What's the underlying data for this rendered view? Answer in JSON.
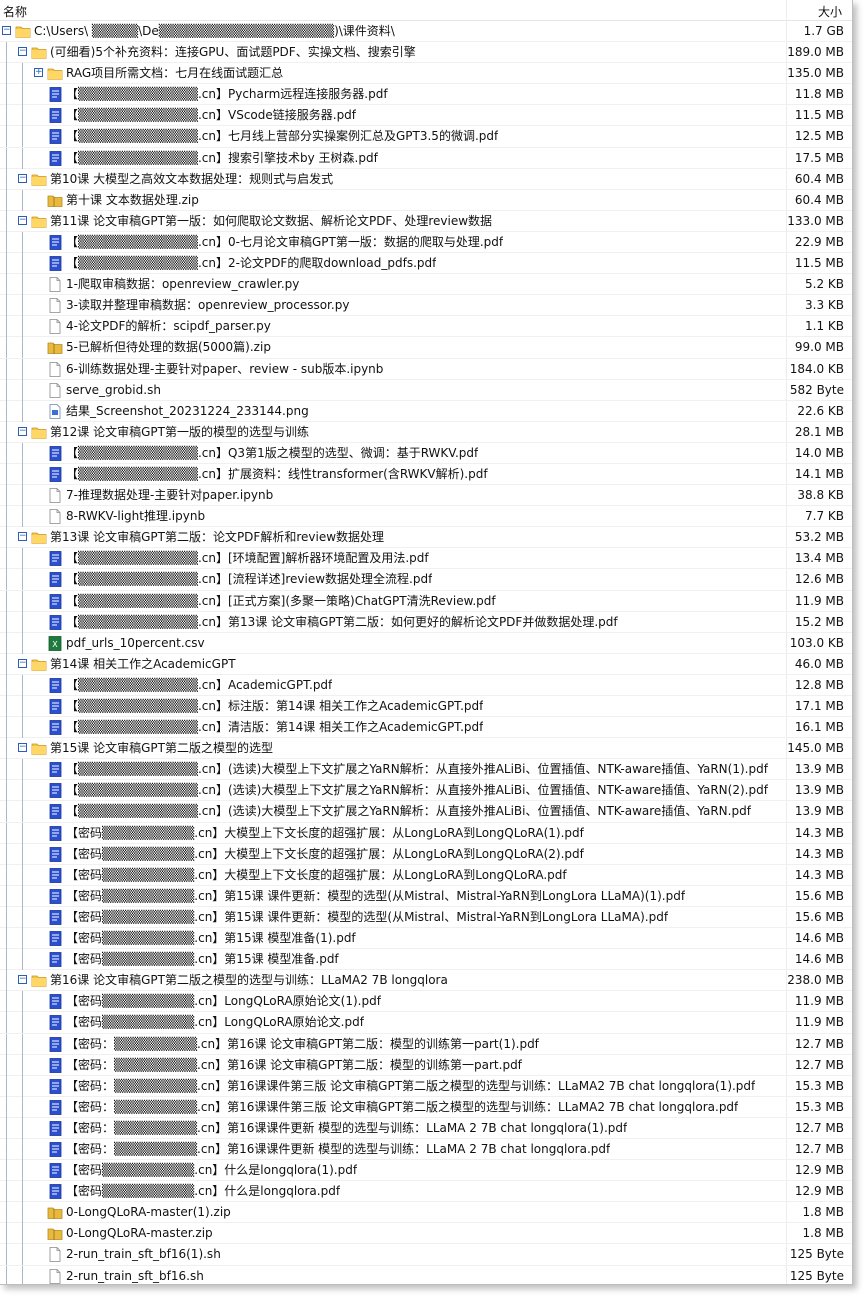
{
  "header": {
    "name_col": "名称",
    "size_col": "大小"
  },
  "items": [
    {
      "level": 0,
      "type": "folder",
      "expanded": true,
      "label": "C:\\Users\\  ▒▒▒▒▒\\De▒▒▒▒▒▒▒▒▒▒▒▒▒▒▒▒▒▒▒)\\课件资料\\",
      "size": "1.7 GB"
    },
    {
      "level": 1,
      "type": "folder",
      "expanded": true,
      "label": "(可细看)5个补充资料：连接GPU、面试题PDF、实操文档、搜索引擎",
      "size": "189.0 MB"
    },
    {
      "level": 2,
      "type": "folder",
      "expanded": false,
      "label": "RAG项目所需文档：七月在线面试题汇总",
      "size": "135.0 MB"
    },
    {
      "level": 2,
      "type": "pdf",
      "label": "【▒▒▒▒▒▒▒▒▒▒▒▒▒.cn】Pycharm远程连接服务器.pdf",
      "size": "11.8 MB"
    },
    {
      "level": 2,
      "type": "pdf",
      "label": "【▒▒▒▒▒▒▒▒▒▒▒▒▒.cn】VScode链接服务器.pdf",
      "size": "11.5 MB"
    },
    {
      "level": 2,
      "type": "pdf",
      "label": "【▒▒▒▒▒▒▒▒▒▒▒▒▒.cn】七月线上营部分实操案例汇总及GPT3.5的微调.pdf",
      "size": "12.5 MB"
    },
    {
      "level": 2,
      "type": "pdf",
      "label": "【▒▒▒▒▒▒▒▒▒▒▒▒▒.cn】搜索引擎技术by 王树森.pdf",
      "size": "17.5 MB"
    },
    {
      "level": 1,
      "type": "folder",
      "expanded": true,
      "label": "第10课 大模型之高效文本数据处理：规则式与启发式",
      "size": "60.4 MB"
    },
    {
      "level": 2,
      "type": "zip",
      "label": "第十课 文本数据处理.zip",
      "size": "60.4 MB"
    },
    {
      "level": 1,
      "type": "folder",
      "expanded": true,
      "label": "第11课 论文审稿GPT第一版：如何爬取论文数据、解析论文PDF、处理review数据",
      "size": "133.0 MB"
    },
    {
      "level": 2,
      "type": "pdf",
      "label": "【▒▒▒▒▒▒▒▒▒▒▒▒▒.cn】0-七月论文审稿GPT第一版：数据的爬取与处理.pdf",
      "size": "22.9 MB"
    },
    {
      "level": 2,
      "type": "pdf",
      "label": "【▒▒▒▒▒▒▒▒▒▒▒▒▒.cn】2-论文PDF的爬取download_pdfs.pdf",
      "size": "11.5 MB"
    },
    {
      "level": 2,
      "type": "file",
      "label": "1-爬取审稿数据：openreview_crawler.py",
      "size": "5.2 KB"
    },
    {
      "level": 2,
      "type": "file",
      "label": "3-读取并整理审稿数据：openreview_processor.py",
      "size": "3.3 KB"
    },
    {
      "level": 2,
      "type": "file",
      "label": "4-论文PDF的解析：scipdf_parser.py",
      "size": "1.1 KB"
    },
    {
      "level": 2,
      "type": "zip",
      "label": "5-已解析但待处理的数据(5000篇).zip",
      "size": "99.0 MB"
    },
    {
      "level": 2,
      "type": "file",
      "label": "6-训练数据处理-主要针对paper、review - sub版本.ipynb",
      "size": "184.0 KB"
    },
    {
      "level": 2,
      "type": "file",
      "label": "serve_grobid.sh",
      "size": "582 Byte"
    },
    {
      "level": 2,
      "type": "image",
      "label": "结果_Screenshot_20231224_233144.png",
      "size": "22.6 KB"
    },
    {
      "level": 1,
      "type": "folder",
      "expanded": true,
      "label": "第12课 论文审稿GPT第一版的模型的选型与训练",
      "size": "28.1 MB"
    },
    {
      "level": 2,
      "type": "pdf",
      "label": "【▒▒▒▒▒▒▒▒▒▒▒▒▒.cn】Q3第1版之模型的选型、微调：基于RWKV.pdf",
      "size": "14.0 MB"
    },
    {
      "level": 2,
      "type": "pdf",
      "label": "【▒▒▒▒▒▒▒▒▒▒▒▒▒.cn】扩展资料：线性transformer(含RWKV解析).pdf",
      "size": "14.1 MB"
    },
    {
      "level": 2,
      "type": "file",
      "label": "7-推理数据处理-主要针对paper.ipynb",
      "size": "38.8 KB"
    },
    {
      "level": 2,
      "type": "file",
      "label": "8-RWKV-light推理.ipynb",
      "size": "7.7 KB"
    },
    {
      "level": 1,
      "type": "folder",
      "expanded": true,
      "label": "第13课 论文审稿GPT第二版：论文PDF解析和review数据处理",
      "size": "53.2 MB"
    },
    {
      "level": 2,
      "type": "pdf",
      "label": "【▒▒▒▒▒▒▒▒▒▒▒▒▒.cn】[环境配置]解析器环境配置及用法.pdf",
      "size": "13.4 MB"
    },
    {
      "level": 2,
      "type": "pdf",
      "label": "【▒▒▒▒▒▒▒▒▒▒▒▒▒.cn】[流程详述]review数据处理全流程.pdf",
      "size": "12.6 MB"
    },
    {
      "level": 2,
      "type": "pdf",
      "label": "【▒▒▒▒▒▒▒▒▒▒▒▒▒.cn】[正式方案](多聚一策略)ChatGPT清洗Review.pdf",
      "size": "11.9 MB"
    },
    {
      "level": 2,
      "type": "pdf",
      "label": "【▒▒▒▒▒▒▒▒▒▒▒▒▒.cn】第13课 论文审稿GPT第二版：如何更好的解析论文PDF并做数据处理.pdf",
      "size": "15.2 MB"
    },
    {
      "level": 2,
      "type": "csv",
      "label": "pdf_urls_10percent.csv",
      "size": "103.0 KB"
    },
    {
      "level": 1,
      "type": "folder",
      "expanded": true,
      "label": "第14课 相关工作之AcademicGPT",
      "size": "46.0 MB"
    },
    {
      "level": 2,
      "type": "pdf",
      "label": "【▒▒▒▒▒▒▒▒▒▒▒▒▒.cn】AcademicGPT.pdf",
      "size": "12.8 MB"
    },
    {
      "level": 2,
      "type": "pdf",
      "label": "【▒▒▒▒▒▒▒▒▒▒▒▒▒.cn】标注版：第14课 相关工作之AcademicGPT.pdf",
      "size": "17.1 MB"
    },
    {
      "level": 2,
      "type": "pdf",
      "label": "【▒▒▒▒▒▒▒▒▒▒▒▒▒.cn】清洁版：第14课 相关工作之AcademicGPT.pdf",
      "size": "16.1 MB"
    },
    {
      "level": 1,
      "type": "folder",
      "expanded": true,
      "label": "第15课 论文审稿GPT第二版之模型的选型",
      "size": "145.0 MB"
    },
    {
      "level": 2,
      "type": "pdf",
      "label": "【▒▒▒▒▒▒▒▒▒▒▒▒▒.cn】(选读)大模型上下文扩展之YaRN解析：从直接外推ALiBi、位置插值、NTK-aware插值、YaRN(1).pdf",
      "size": "13.9 MB"
    },
    {
      "level": 2,
      "type": "pdf",
      "label": "【▒▒▒▒▒▒▒▒▒▒▒▒▒.cn】(选读)大模型上下文扩展之YaRN解析：从直接外推ALiBi、位置插值、NTK-aware插值、YaRN(2).pdf",
      "size": "13.9 MB"
    },
    {
      "level": 2,
      "type": "pdf",
      "label": "【▒▒▒▒▒▒▒▒▒▒▒▒▒.cn】(选读)大模型上下文扩展之YaRN解析：从直接外推ALiBi、位置插值、NTK-aware插值、YaRN.pdf",
      "size": "13.9 MB"
    },
    {
      "level": 2,
      "type": "pdf",
      "label": "【密码▒▒▒▒▒▒▒▒▒▒.cn】大模型上下文长度的超强扩展：从LongLoRA到LongQLoRA(1).pdf",
      "size": "14.3 MB"
    },
    {
      "level": 2,
      "type": "pdf",
      "label": "【密码▒▒▒▒▒▒▒▒▒▒.cn】大模型上下文长度的超强扩展：从LongLoRA到LongQLoRA(2).pdf",
      "size": "14.3 MB"
    },
    {
      "level": 2,
      "type": "pdf",
      "label": "【密码▒▒▒▒▒▒▒▒▒▒.cn】大模型上下文长度的超强扩展：从LongLoRA到LongQLoRA.pdf",
      "size": "14.3 MB"
    },
    {
      "level": 2,
      "type": "pdf",
      "label": "【密码▒▒▒▒▒▒▒▒▒▒.cn】第15课 课件更新：模型的选型(从Mistral、Mistral-YaRN到LongLora LLaMA)(1).pdf",
      "size": "15.6 MB"
    },
    {
      "level": 2,
      "type": "pdf",
      "label": "【密码▒▒▒▒▒▒▒▒▒▒.cn】第15课 课件更新：模型的选型(从Mistral、Mistral-YaRN到LongLora LLaMA).pdf",
      "size": "15.6 MB"
    },
    {
      "level": 2,
      "type": "pdf",
      "label": "【密码▒▒▒▒▒▒▒▒▒▒.cn】第15课 模型准备(1).pdf",
      "size": "14.6 MB"
    },
    {
      "level": 2,
      "type": "pdf",
      "label": "【密码▒▒▒▒▒▒▒▒▒▒.cn】第15课 模型准备.pdf",
      "size": "14.6 MB"
    },
    {
      "level": 1,
      "type": "folder",
      "expanded": true,
      "label": "第16课 论文审稿GPT第二版之模型的选型与训练：LLaMA2 7B longqlora",
      "size": "238.0 MB"
    },
    {
      "level": 2,
      "type": "pdf",
      "label": "【密码▒▒▒▒▒▒▒▒▒▒.cn】LongQLoRA原始论文(1).pdf",
      "size": "11.9 MB"
    },
    {
      "level": 2,
      "type": "pdf",
      "label": "【密码▒▒▒▒▒▒▒▒▒▒.cn】LongQLoRA原始论文.pdf",
      "size": "11.9 MB"
    },
    {
      "level": 2,
      "type": "pdf",
      "label": "【密码：▒▒▒▒▒▒▒▒▒.cn】第16课 论文审稿GPT第二版：模型的训练第一part(1).pdf",
      "size": "12.7 MB"
    },
    {
      "level": 2,
      "type": "pdf",
      "label": "【密码：▒▒▒▒▒▒▒▒▒.cn】第16课 论文审稿GPT第二版：模型的训练第一part.pdf",
      "size": "12.7 MB"
    },
    {
      "level": 2,
      "type": "pdf",
      "label": "【密码：▒▒▒▒▒▒▒▒▒.cn】第16课课件第三版 论文审稿GPT第二版之模型的选型与训练：LLaMA2 7B chat longqlora(1).pdf",
      "size": "15.3 MB"
    },
    {
      "level": 2,
      "type": "pdf",
      "label": "【密码：▒▒▒▒▒▒▒▒▒.cn】第16课课件第三版 论文审稿GPT第二版之模型的选型与训练：LLaMA2 7B chat longqlora.pdf",
      "size": "15.3 MB"
    },
    {
      "level": 2,
      "type": "pdf",
      "label": "【密码：▒▒▒▒▒▒▒▒▒.cn】第16课课件更新 模型的选型与训练：LLaMA 2 7B chat longqlora(1).pdf",
      "size": "12.7 MB"
    },
    {
      "level": 2,
      "type": "pdf",
      "label": "【密码：▒▒▒▒▒▒▒▒▒.cn】第16课课件更新 模型的选型与训练：LLaMA 2 7B chat longqlora.pdf",
      "size": "12.7 MB"
    },
    {
      "level": 2,
      "type": "pdf",
      "label": "【密码▒▒▒▒▒▒▒▒▒▒.cn】什么是longqlora(1).pdf",
      "size": "12.9 MB"
    },
    {
      "level": 2,
      "type": "pdf",
      "label": "【密码▒▒▒▒▒▒▒▒▒▒.cn】什么是longqlora.pdf",
      "size": "12.9 MB"
    },
    {
      "level": 2,
      "type": "zip",
      "label": "0-LongQLoRA-master(1).zip",
      "size": "1.8 MB"
    },
    {
      "level": 2,
      "type": "zip",
      "label": "0-LongQLoRA-master.zip",
      "size": "1.8 MB"
    },
    {
      "level": 2,
      "type": "file",
      "label": "2-run_train_sft_bf16(1).sh",
      "size": "125 Byte"
    },
    {
      "level": 2,
      "type": "file",
      "label": "2-run_train_sft_bf16.sh",
      "size": "125 Byte"
    }
  ]
}
